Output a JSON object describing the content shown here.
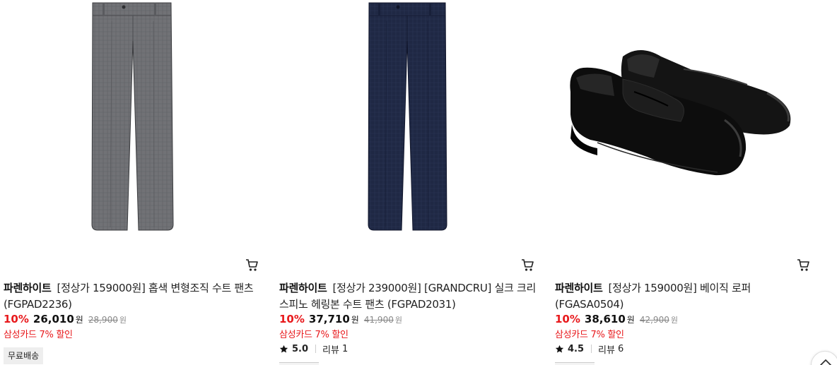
{
  "products": [
    {
      "brand": "파렌하이트",
      "name": "[정상가 159000원] 홉색 변형조직 수트 팬츠 (FGPAD2236)",
      "discount": "10%",
      "price": "26,010",
      "price_unit": "원",
      "original_price": "28,900",
      "original_unit": "원",
      "promo": "삼성카드 7% 할인",
      "badge": "무료배송",
      "image_icon": "grey-suit-pants-image",
      "cart_icon": "cart-icon"
    },
    {
      "brand": "파렌하이트",
      "name": "[정상가 239000원] [GRANDCRU] 실크 크리스피노 헤링본 수트 팬츠 (FGPAD2031)",
      "discount": "10%",
      "price": "37,710",
      "price_unit": "원",
      "original_price": "41,900",
      "original_unit": "원",
      "promo": "삼성카드 7% 할인",
      "rating": "5.0",
      "review_label": "리뷰",
      "review_count": "1",
      "image_icon": "navy-suit-pants-image",
      "cart_icon": "cart-icon"
    },
    {
      "brand": "파렌하이트",
      "name": "[정상가 159000원] 베이직 로퍼 (FGASA0504)",
      "discount": "10%",
      "price": "38,610",
      "price_unit": "원",
      "original_price": "42,900",
      "original_unit": "원",
      "promo": "삼성카드 7% 할인",
      "rating": "4.5",
      "review_label": "리뷰",
      "review_count": "6",
      "image_icon": "black-loafers-image",
      "cart_icon": "cart-icon"
    }
  ],
  "icons": {
    "star": "star-icon",
    "top": "chevron-up-icon"
  },
  "colors": {
    "discount": "#e8191c",
    "grey_pants": "#6f7074",
    "navy_pants": "#1f2844",
    "loafer": "#141414"
  }
}
